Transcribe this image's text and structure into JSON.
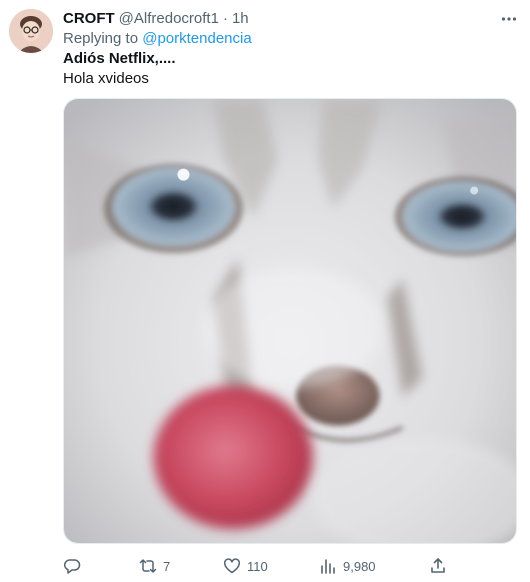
{
  "tweet": {
    "display_name": "CROFT",
    "handle": "@Alfredocroft1",
    "separator": "·",
    "time": "1h",
    "replying_to_prefix": "Replying to",
    "replying_to_mention": "@porktendencia",
    "text_line1": "Adiós Netflix,....",
    "text_line2": "Hola xvideos"
  },
  "actions": {
    "reply_count": "",
    "retweet_count": "7",
    "like_count": "110",
    "view_count": "9,980"
  },
  "icons": {
    "more": "more-horizontal-icon",
    "reply": "reply-icon",
    "retweet": "retweet-icon",
    "like": "heart-icon",
    "views": "bar-chart-icon",
    "share": "share-icon"
  },
  "colors": {
    "text": "#0f1419",
    "secondary": "#536471",
    "link": "#1d9bf0"
  }
}
